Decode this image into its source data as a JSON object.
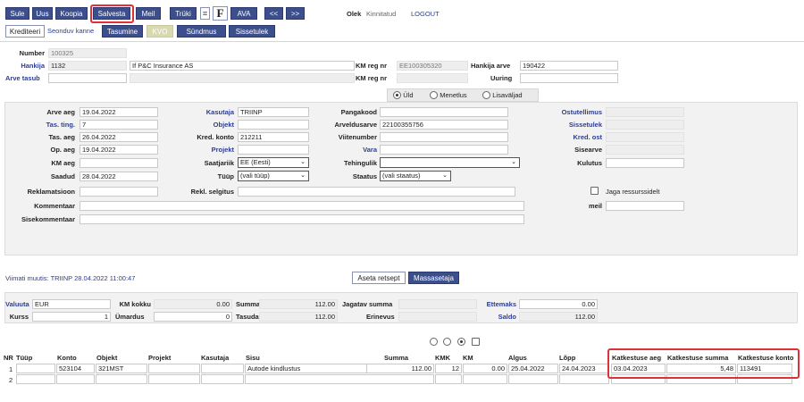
{
  "toolbar": {
    "sule": "Sule",
    "uus": "Uus",
    "koopia": "Koopia",
    "salvesta": "Salvesta",
    "meil": "Meil",
    "trüki": "Trüki",
    "f": "F",
    "ava": "AVA",
    "prev": "<<",
    "next": ">>",
    "olek_label": "Olek",
    "olek_value": "Kinnitatud",
    "logout": "LOGOUT"
  },
  "tabs": {
    "krediteeri": "Krediteeri",
    "seonduv": "Seonduv kanne",
    "tasumine": "Tasumine",
    "kvo": "KVO",
    "syndmus": "Sündmus",
    "sissetulek": "Sissetulek"
  },
  "header": {
    "number_label": "Number",
    "number_value": "100325",
    "hankija_label": "Hankija",
    "hankija_value": "1132",
    "hankija_name": "If P&C Insurance AS",
    "kmreg_label": "KM reg nr",
    "kmreg_value": "EE100305320",
    "hankija_arve_label": "Hankija arve",
    "hankija_arve_value": "190422",
    "arve_tasub_label": "Arve tasub",
    "kmreg2_label": "KM reg nr",
    "uuring_label": "Uuring"
  },
  "view_tabs": {
    "yld": "Üld",
    "menetlus": "Menetlus",
    "lisavaljad": "Lisaväljad",
    "selected": "yld"
  },
  "form": {
    "arve_aeg_label": "Arve aeg",
    "arve_aeg": "19.04.2022",
    "tas_ting_label": "Tas. ting.",
    "tas_ting": "7",
    "tas_aeg_label": "Tas. aeg",
    "tas_aeg": "26.04.2022",
    "op_aeg_label": "Op. aeg",
    "op_aeg": "19.04.2022",
    "km_aeg_label": "KM aeg",
    "saadud_label": "Saadud",
    "saadud": "28.04.2022",
    "reklamatsioon_label": "Reklamatsioon",
    "kommentaar_label": "Kommentaar",
    "sisekommentaar_label": "Sisekommentaar",
    "kasutaja_label": "Kasutaja",
    "kasutaja": "TRIINP",
    "objekt_label": "Objekt",
    "kred_konto_label": "Kred. konto",
    "kred_konto": "212211",
    "projekt_label": "Projekt",
    "saatjariik_label": "Saatjariik",
    "saatjariik": "EE (Eesti)",
    "tyyp_label": "Tüüp",
    "tyyp": "(vali tüüp)",
    "rekl_selgitus_label": "Rekl. selgitus",
    "pangakood_label": "Pangakood",
    "arveldusarve_label": "Arveldusarve",
    "arveldusarve": "22100355756",
    "viitenumber_label": "Viitenumber",
    "vara_label": "Vara",
    "tehingulik_label": "Tehingulik",
    "staatus_label": "Staatus",
    "staatus": "(vali staatus)",
    "ostutellimus_label": "Ostutellimus",
    "sissetulek_label": "Sissetulek",
    "kred_ost_label": "Kred. ost",
    "sisearve_label": "Sisearve",
    "kulutus_label": "Kulutus",
    "jaga_label": "Jaga ressurssidelt",
    "meil_label": "meil"
  },
  "footer": {
    "viimati": "Viimati muutis: TRIINP 28.04.2022 11:00:47",
    "aseta_retsept": "Aseta retsept",
    "massasetaja": "Massasetaja"
  },
  "totals": {
    "valuuta_label": "Valuuta",
    "valuuta": "EUR",
    "km_kokku_label": "KM kokku",
    "km_kokku": "0.00",
    "summa_label": "Summa",
    "summa": "112.00",
    "jagatav_label": "Jagatav summa",
    "ettemaks_label": "Ettemaks",
    "ettemaks": "0.00",
    "kurss_label": "Kurss",
    "kurss": "1",
    "umardus_label": "Ümardus",
    "umardus": "0",
    "tasuda_label": "Tasuda",
    "tasuda": "112.00",
    "erinevus_label": "Erinevus",
    "saldo_label": "Saldo",
    "saldo": "112.00"
  },
  "grid": {
    "columns": [
      "NR",
      "Tüüp",
      "Konto",
      "Objekt",
      "Projekt",
      "Kasutaja",
      "Sisu",
      "Summa",
      "KMK",
      "KM",
      "Algus",
      "Lõpp",
      "Katkestuse aeg",
      "Katkestuse summa",
      "Katkestuse konto"
    ],
    "rows": [
      {
        "nr": "1",
        "tyyp": "",
        "konto": "523104",
        "objekt": "321MST",
        "projekt": "",
        "kasutaja": "",
        "sisu": "Autode kindlustus",
        "summa": "112.00",
        "kmk": "12",
        "km": "0.00",
        "algus": "25.04.2022",
        "lopp": "24.04.2023",
        "katk_aeg": "03.04.2023",
        "katk_summa": "5,48",
        "katk_konto": "113491"
      },
      {
        "nr": "2"
      }
    ]
  },
  "colors": {
    "button": "#3c4f8c",
    "link": "#2c3d96",
    "highlight": "#e0303a",
    "panel": "#f2f2f2"
  },
  "icons": {
    "attach": "paperclip-icon",
    "radio_row": "radio-icon",
    "checkbox": "checkbox-icon"
  }
}
